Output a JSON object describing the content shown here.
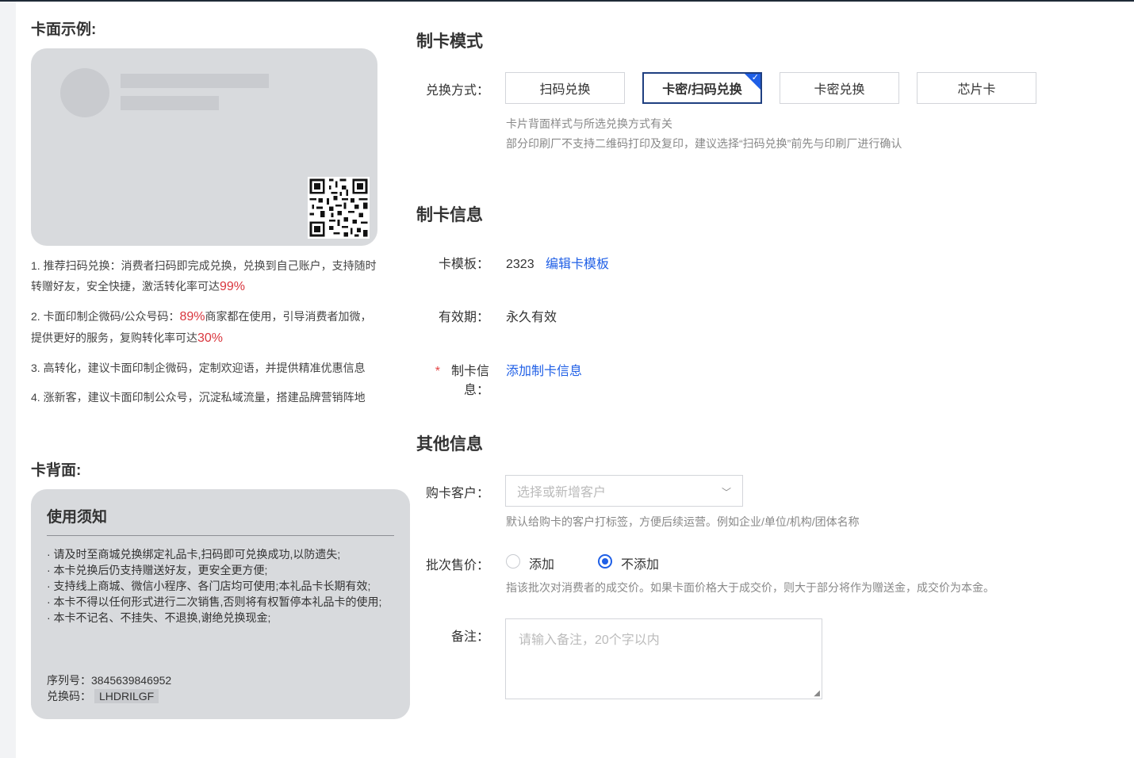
{
  "left": {
    "front_title": "卡面示例:",
    "tips": [
      {
        "text": "1. 推荐扫码兑换：消费者扫码即完成兑换，兑换到自己账户，支持随时转赠好友，安全快捷，激活转化率可达",
        "highlight": "99%",
        "after": ""
      },
      {
        "text": "2. 卡面印制企微码/公众号码：",
        "highlight": "89%",
        "after": "商家都在使用，引导消费者加微，提供更好的服务，复购转化率可达",
        "highlight2": "30%"
      },
      {
        "text": "3. 高转化，建议卡面印制企微码，定制欢迎语，并提供精准优惠信息"
      },
      {
        "text": "4. 涨新客，建议卡面印制公众号，沉淀私域流量，搭建品牌营销阵地"
      }
    ],
    "back_title": "卡背面:",
    "back_card": {
      "title": "使用须知",
      "notes": [
        "· 请及时至商城兑换绑定礼品卡,扫码即可兑换成功,以防遗失;",
        "· 本卡兑换后仍支持赠送好友，更安全更方便;",
        "· 支持线上商城、微信小程序、各门店均可使用;本礼品卡长期有效;",
        "· 本卡不得以任何形式进行二次销售,否则将有权暂停本礼品卡的使用;",
        "· 本卡不记名、不挂失、不退换,谢绝兑换现金;"
      ],
      "serial_label": "序列号：",
      "serial_value": "3845639846952",
      "code_label": "兑换码：",
      "code_value": "LHDRILGF"
    }
  },
  "mode": {
    "title": "制卡模式",
    "label": "兑换方式：",
    "options": [
      "扫码兑换",
      "卡密/扫码兑换",
      "卡密兑换",
      "芯片卡"
    ],
    "selected_index": 1,
    "hint1": "卡片背面样式与所选兑换方式有关",
    "hint2": "部分印刷厂不支持二维码打印及复印，建议选择“扫码兑换”前先与印刷厂进行确认"
  },
  "info": {
    "title": "制卡信息",
    "template_label": "卡模板：",
    "template_value": "2323",
    "template_link": "编辑卡模板",
    "validity_label": "有效期：",
    "validity_value": "永久有效",
    "card_info_required": "*",
    "card_info_label": "制卡信息：",
    "card_info_link": "添加制卡信息"
  },
  "other": {
    "title": "其他信息",
    "customer_label": "购卡客户：",
    "customer_placeholder": "选择或新增客户",
    "customer_hint": "默认给购卡的客户打标签，方便后续运营。例如企业/单位/机构/团体名称",
    "price_label": "批次售价：",
    "price_options": [
      "添加",
      "不添加"
    ],
    "price_selected_index": 1,
    "price_hint": "指该批次对消费者的成交价。如果卡面价格大于成交价，则大于部分将作为赠送金，成交价为本金。",
    "remark_label": "备注：",
    "remark_placeholder": "请输入备注，20个字以内"
  },
  "colors": {
    "accent": "#1f5fe6",
    "highlight": "#d9363e",
    "selected_border": "#1f3f80"
  },
  "icons": {
    "chevron": "chevron-down-icon",
    "check": "check-icon",
    "qr": "qr-code-icon"
  }
}
